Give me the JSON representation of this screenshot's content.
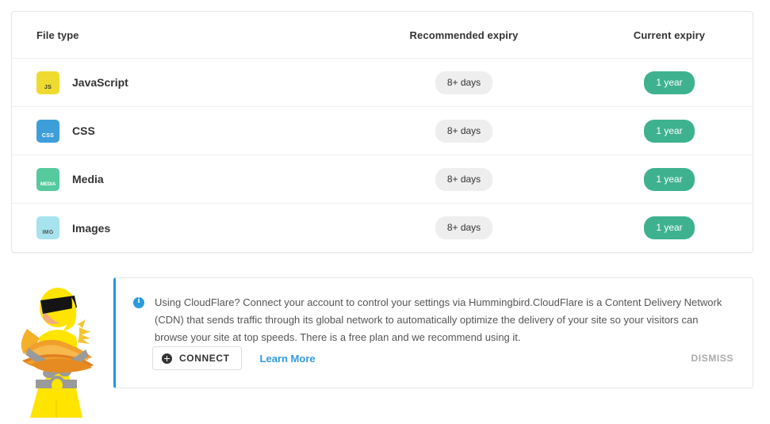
{
  "table": {
    "columns": [
      {
        "key": "file_type",
        "label": "File type"
      },
      {
        "key": "recommended_expiry",
        "label": "Recommended expiry"
      },
      {
        "key": "current_expiry",
        "label": "Current expiry"
      }
    ],
    "rows": [
      {
        "name": "JavaScript",
        "icon_label": "JS",
        "icon_bg": "#efdb2f",
        "icon_fg": "#333333",
        "recommended_expiry": "8+ days",
        "current_expiry": "1 year"
      },
      {
        "name": "CSS",
        "icon_label": "CSS",
        "icon_bg": "#3e9ed9",
        "icon_fg": "#ffffff",
        "recommended_expiry": "8+ days",
        "current_expiry": "1 year"
      },
      {
        "name": "Media",
        "icon_label": "MEDIA",
        "icon_bg": "#55ca9e",
        "icon_fg": "#ffffff",
        "recommended_expiry": "8+ days",
        "current_expiry": "1 year"
      },
      {
        "name": "Images",
        "icon_label": "IMG",
        "icon_bg": "#a6e3ef",
        "icon_fg": "#555555",
        "recommended_expiry": "8+ days",
        "current_expiry": "1 year"
      }
    ]
  },
  "notice": {
    "icon": "info-icon",
    "message": "Using CloudFlare? Connect your account to control your settings via Hummingbird.CloudFlare is a Content Delivery Network (CDN) that sends traffic through its global network to automatically optimize the delivery of your site so your visitors can browse your site at top speeds. There is a free plan and we recommend using it.",
    "connect_label": "CONNECT",
    "learn_more_label": "Learn More",
    "dismiss_label": "DISMISS",
    "accent_color": "#2196e3",
    "link_color": "#309be2"
  },
  "mascot": {
    "name": "hummingbird-superhero-mascot",
    "suit_color": "#ffe400",
    "bread_color": "#f0a02a",
    "visor_color": "#1a1a1a",
    "belt_color": "#9a9a9a"
  }
}
